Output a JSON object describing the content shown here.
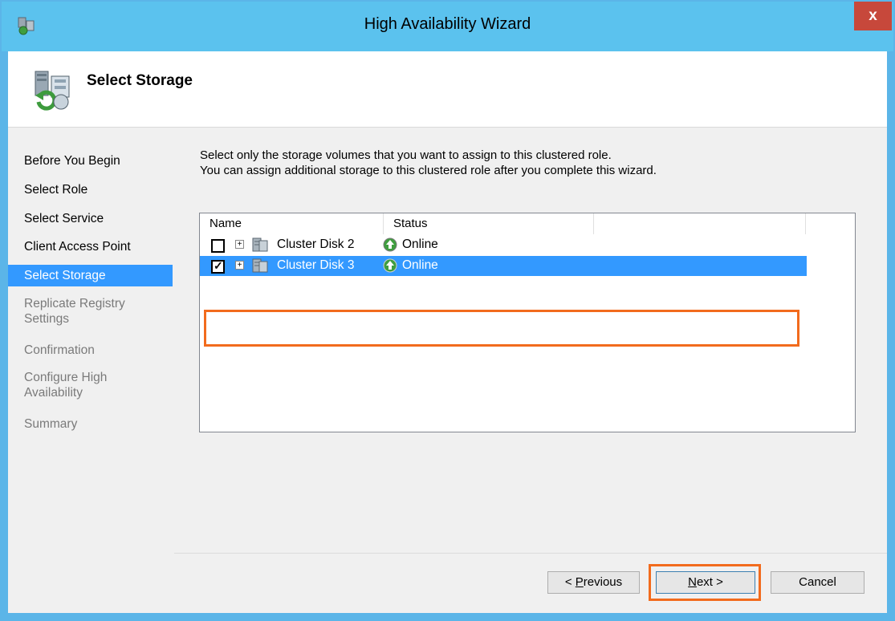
{
  "window": {
    "title": "High Availability Wizard",
    "close_label": "x"
  },
  "header": {
    "title": "Select Storage"
  },
  "nav": {
    "items": [
      {
        "label": "Before You Begin",
        "state": "normal"
      },
      {
        "label": "Select Role",
        "state": "normal"
      },
      {
        "label": "Select Service",
        "state": "normal"
      },
      {
        "label": "Client Access Point",
        "state": "normal"
      },
      {
        "label": "Select Storage",
        "state": "selected"
      },
      {
        "label": "Replicate Registry",
        "label2": "Settings",
        "state": "disabled"
      },
      {
        "label": "Confirmation",
        "state": "disabled"
      },
      {
        "label": "Configure High",
        "label2": "Availability",
        "state": "disabled"
      },
      {
        "label": "Summary",
        "state": "disabled"
      }
    ]
  },
  "content": {
    "instruction_line1": "Select only the storage volumes that you want to assign to this clustered role.",
    "instruction_line2": "You can assign additional storage to this clustered role after you complete this wizard."
  },
  "storage_list": {
    "columns": [
      "Name",
      "Status",
      ""
    ],
    "rows": [
      {
        "checked": false,
        "expander": "+",
        "name": "Cluster Disk 2",
        "status": "Online",
        "selected": false
      },
      {
        "checked": true,
        "expander": "+",
        "name": "Cluster Disk 3",
        "status": "Online",
        "selected": true
      }
    ]
  },
  "buttons": {
    "previous_prefix": "< ",
    "previous_mnemonic": "P",
    "previous_rest": "revious",
    "next_mnemonic": "N",
    "next_rest": "ext >",
    "cancel": "Cancel"
  },
  "colors": {
    "titlebar": "#5bc2ee",
    "selection": "#3399ff",
    "highlight": "#f26b1d",
    "close_button": "#c7483b"
  }
}
